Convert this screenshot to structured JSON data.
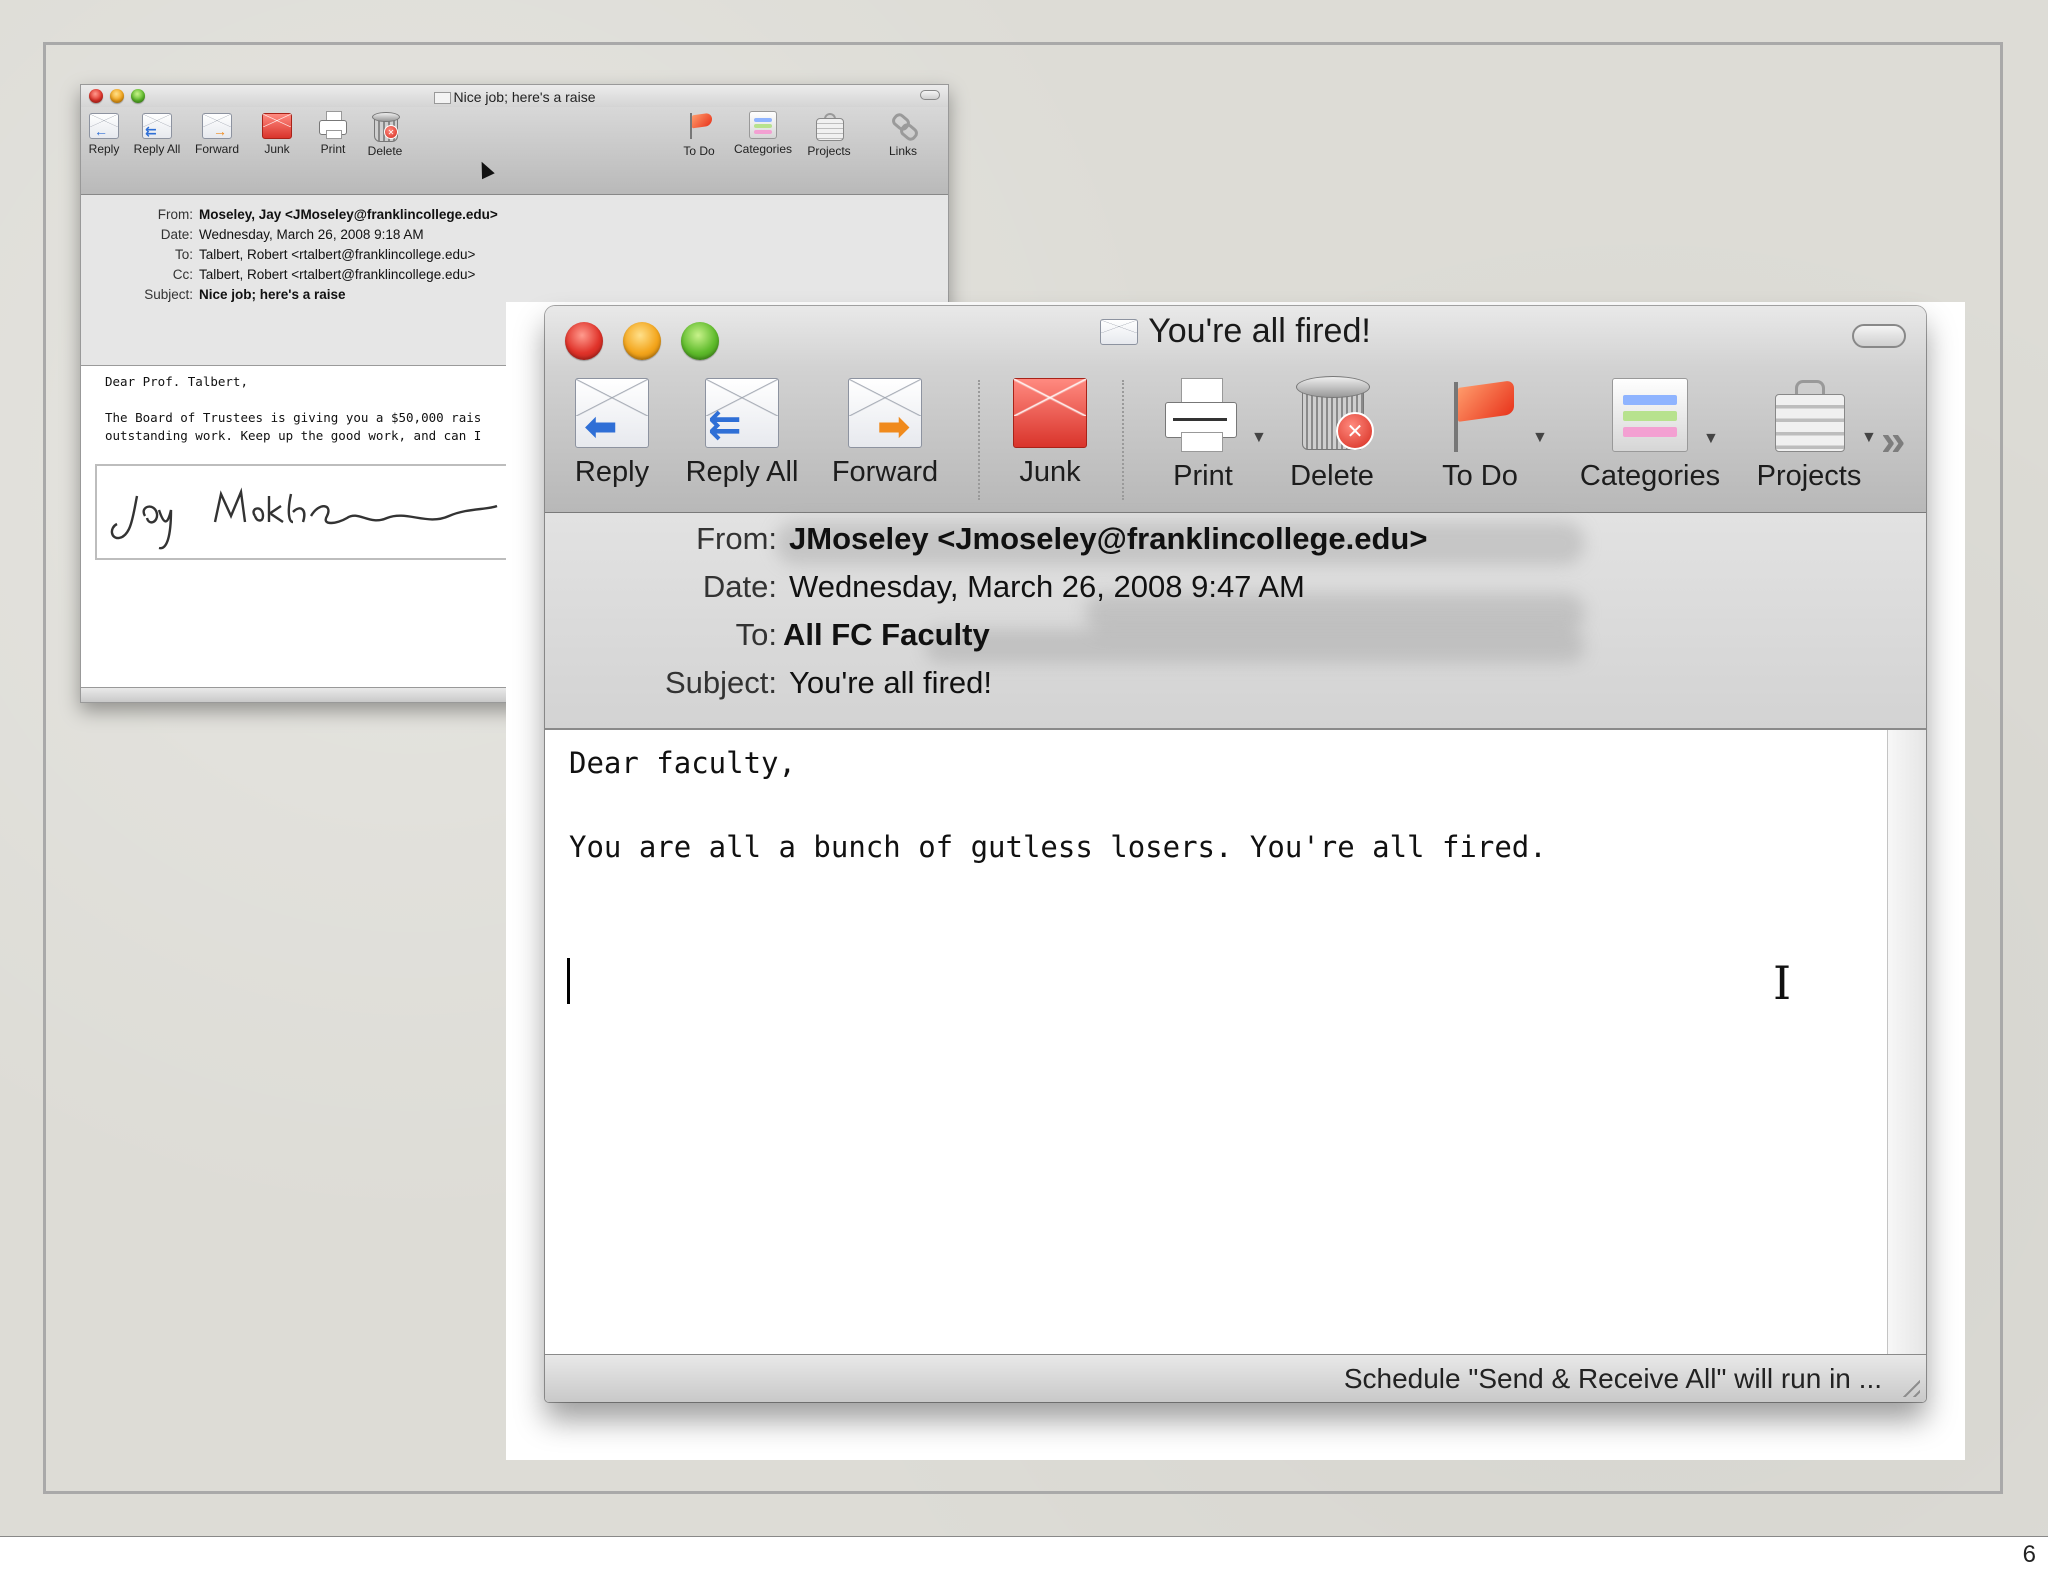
{
  "slide": {
    "page_number": "6"
  },
  "back_window": {
    "title": "Nice job; here's a raise",
    "toolbar": {
      "reply": "Reply",
      "reply_all": "Reply All",
      "forward": "Forward",
      "junk": "Junk",
      "print": "Print",
      "delete": "Delete",
      "todo": "To Do",
      "categories": "Categories",
      "projects": "Projects",
      "links": "Links"
    },
    "headers": {
      "from_label": "From:",
      "from": "Moseley, Jay <JMoseley@franklincollege.edu>",
      "date_label": "Date:",
      "date": "Wednesday, March 26, 2008 9:18 AM",
      "to_label": "To:",
      "to": "Talbert, Robert <rtalbert@franklincollege.edu>",
      "cc_label": "Cc:",
      "cc": "Talbert, Robert <rtalbert@franklincollege.edu>",
      "subject_label": "Subject:",
      "subject": "Nice job; here's a raise"
    },
    "body": {
      "greeting": "Dear Prof. Talbert,",
      "line1": "The Board of Trustees is giving you a $50,000 rais",
      "line2": "outstanding work. Keep up the good work, and can I"
    }
  },
  "front_window": {
    "title": "You're all fired!",
    "toolbar": {
      "reply": "Reply",
      "reply_all": "Reply All",
      "forward": "Forward",
      "junk": "Junk",
      "print": "Print",
      "delete": "Delete",
      "todo": "To Do",
      "categories": "Categories",
      "projects": "Projects",
      "overflow": "»"
    },
    "headers": {
      "from_label": "From:",
      "from": "JMoseley <Jmoseley@franklincollege.edu>",
      "date_label": "Date:",
      "date": "Wednesday, March 26, 2008 9:47 AM",
      "to_label": "To:",
      "to": "All FC Faculty",
      "subject_label": "Subject:",
      "subject": "You're all fired!"
    },
    "body": {
      "greeting": "Dear faculty,",
      "line1": "You are all a bunch of gutless losers. You're all fired."
    },
    "status": "Schedule \"Send & Receive All\" will run in ..."
  },
  "colors": {
    "background": "#dddcd6",
    "close": "#e0332a",
    "minimize": "#f3a51c",
    "zoom": "#5fbb2c",
    "arrow_blue": "#2f6fd6",
    "arrow_orange": "#f08a1c"
  },
  "icons": [
    "reply-icon",
    "reply-all-icon",
    "forward-icon",
    "junk-icon",
    "print-icon",
    "delete-icon",
    "todo-flag-icon",
    "categories-icon",
    "projects-icon",
    "links-icon",
    "envelope-icon"
  ]
}
